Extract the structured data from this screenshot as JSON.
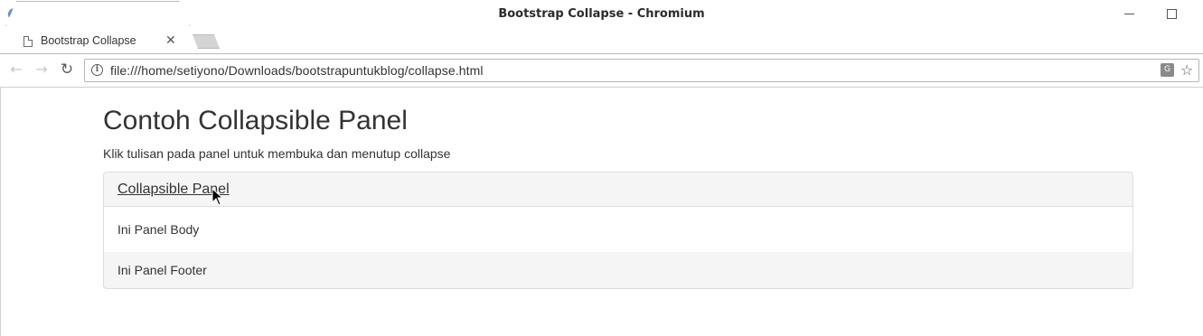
{
  "window": {
    "title": "Bootstrap Collapse - Chromium"
  },
  "tabs": [
    {
      "label": "Bootstrap Collapse",
      "close": "✕"
    }
  ],
  "toolbar": {
    "back": "←",
    "forward": "→",
    "reload": "↻",
    "url": "file:///home/setiyono/Downloads/bootstrapuntukblog/collapse.html",
    "info": "i",
    "translate": "G",
    "bookmark": "☆"
  },
  "page": {
    "heading": "Contoh Collapsible Panel",
    "description": "Klik tulisan pada panel untuk membuka dan menutup collapse",
    "panel": {
      "title": "Collapsible Panel",
      "body": "Ini Panel Body",
      "footer": "Ini Panel Footer"
    }
  }
}
